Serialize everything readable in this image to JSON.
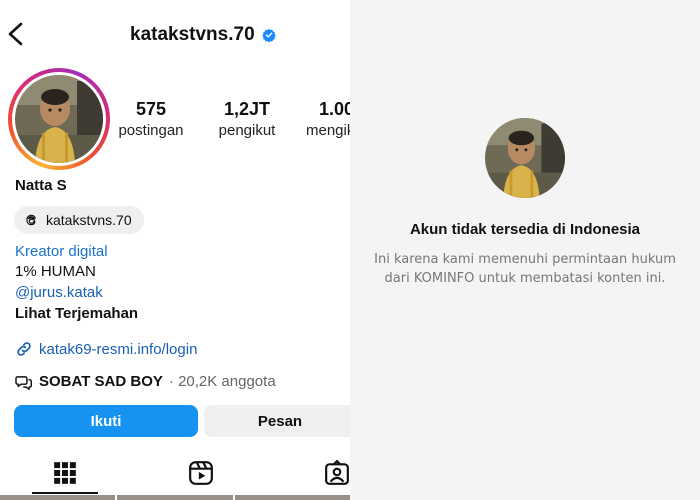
{
  "profile": {
    "username": "katakstvns.70",
    "verified": true,
    "display_name": "Natta S",
    "stats": [
      {
        "value": "575",
        "label": "postingan"
      },
      {
        "value": "1,2JT",
        "label": "pengikut"
      },
      {
        "value": "1.00",
        "label": "mengikuti"
      }
    ],
    "threads_handle": "katakstvns.70",
    "bio": {
      "category": "Kreator digital",
      "line": "1% HUMAN",
      "mention": "@jurus.katak",
      "translate_label": "Lihat Terjemahan"
    },
    "link": "katak69-resmi.info/login",
    "community": {
      "name": "SOBAT SAD BOY",
      "meta": "· 20,2K anggota"
    },
    "buttons": {
      "follow": "Ikuti",
      "message": "Pesan"
    },
    "tabs": [
      "grid-icon",
      "reels-icon",
      "tagged-icon"
    ]
  },
  "unavailable": {
    "title": "Akun tidak tersedia di Indonesia",
    "desc_line1": "Ini karena kami memenuhi permintaan hukum",
    "desc_line2": "dari KOMINFO untuk membatasi konten ini."
  },
  "colors": {
    "accent_blue": "#1692f0",
    "link_blue": "#1a5fb4",
    "verified_blue": "#1a8cff",
    "right_bg": "#f4f4f4"
  }
}
